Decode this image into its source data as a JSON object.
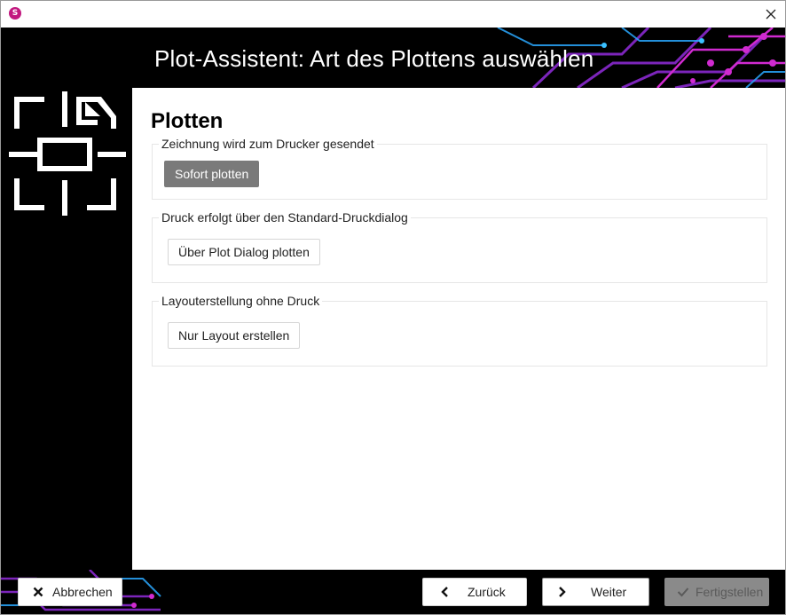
{
  "window": {
    "title": ""
  },
  "header": {
    "title": "Plot-Assistent: Art des Plottens auswählen"
  },
  "main": {
    "section_title": "Plotten",
    "groups": [
      {
        "legend": "Zeichnung wird zum Drucker gesendet",
        "button": "Sofort plotten",
        "selected": true
      },
      {
        "legend": "Druck erfolgt über den Standard-Druckdialog",
        "button": "Über Plot Dialog plotten",
        "selected": false
      },
      {
        "legend": "Layouterstellung ohne Druck",
        "button": "Nur Layout erstellen",
        "selected": false
      }
    ]
  },
  "footer": {
    "cancel": "Abbrechen",
    "back": "Zurück",
    "next": "Weiter",
    "finish": "Fertigstellen"
  },
  "colors": {
    "app_icon": "#c2187f",
    "header_bg": "#000000",
    "accent_magenta": "#d02ad0",
    "accent_blue": "#2aa8ff"
  },
  "icons": [
    "app-icon",
    "close-icon",
    "plot-area-icon",
    "x-icon",
    "chevron-left-icon",
    "chevron-right-icon",
    "checkmark-icon"
  ]
}
